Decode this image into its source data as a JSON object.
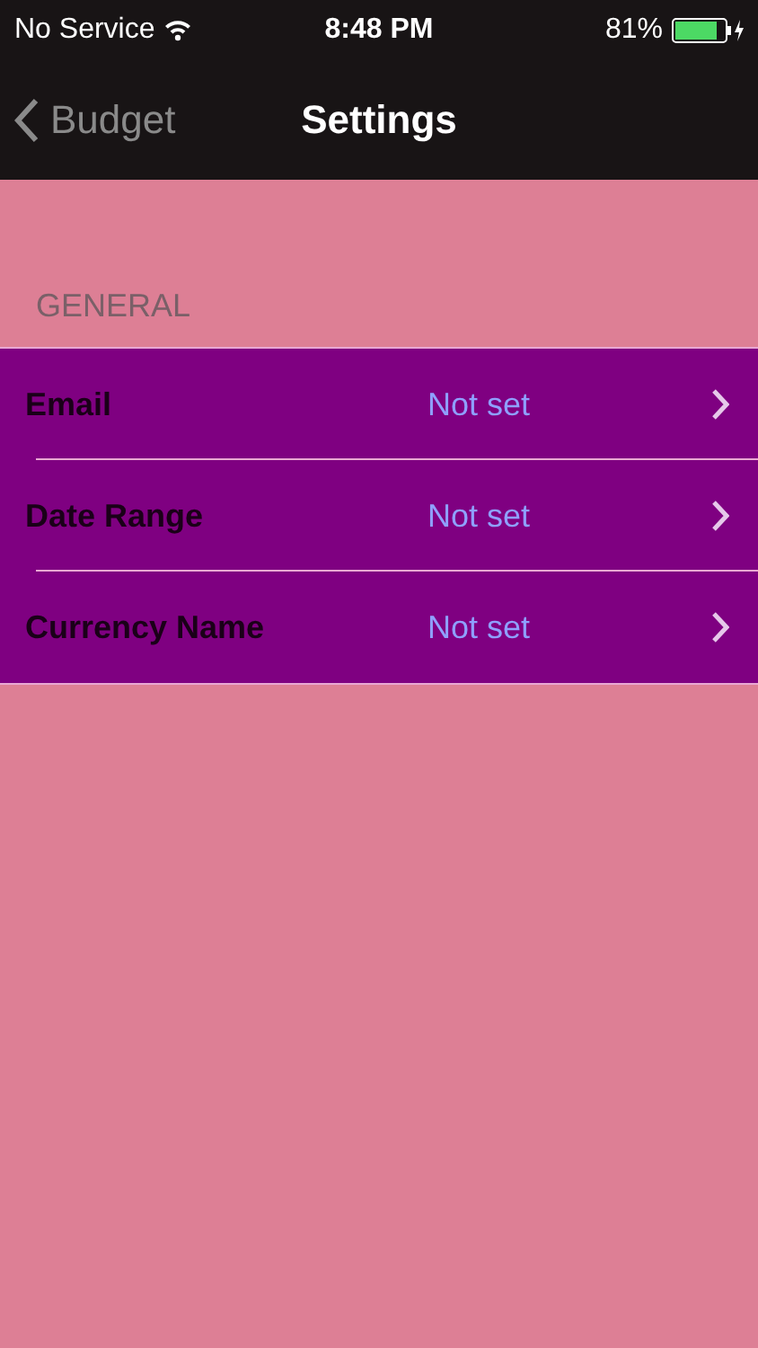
{
  "status_bar": {
    "carrier": "No Service",
    "time": "8:48 PM",
    "battery": "81%"
  },
  "nav_bar": {
    "back": "Budget",
    "title": "Settings"
  },
  "sections": [
    {
      "header": "GENERAL",
      "rows": [
        {
          "label": "Email",
          "value": "Not set"
        },
        {
          "label": "Date Range",
          "value": "Not set"
        },
        {
          "label": "Currency Name",
          "value": "Not set"
        }
      ]
    }
  ]
}
